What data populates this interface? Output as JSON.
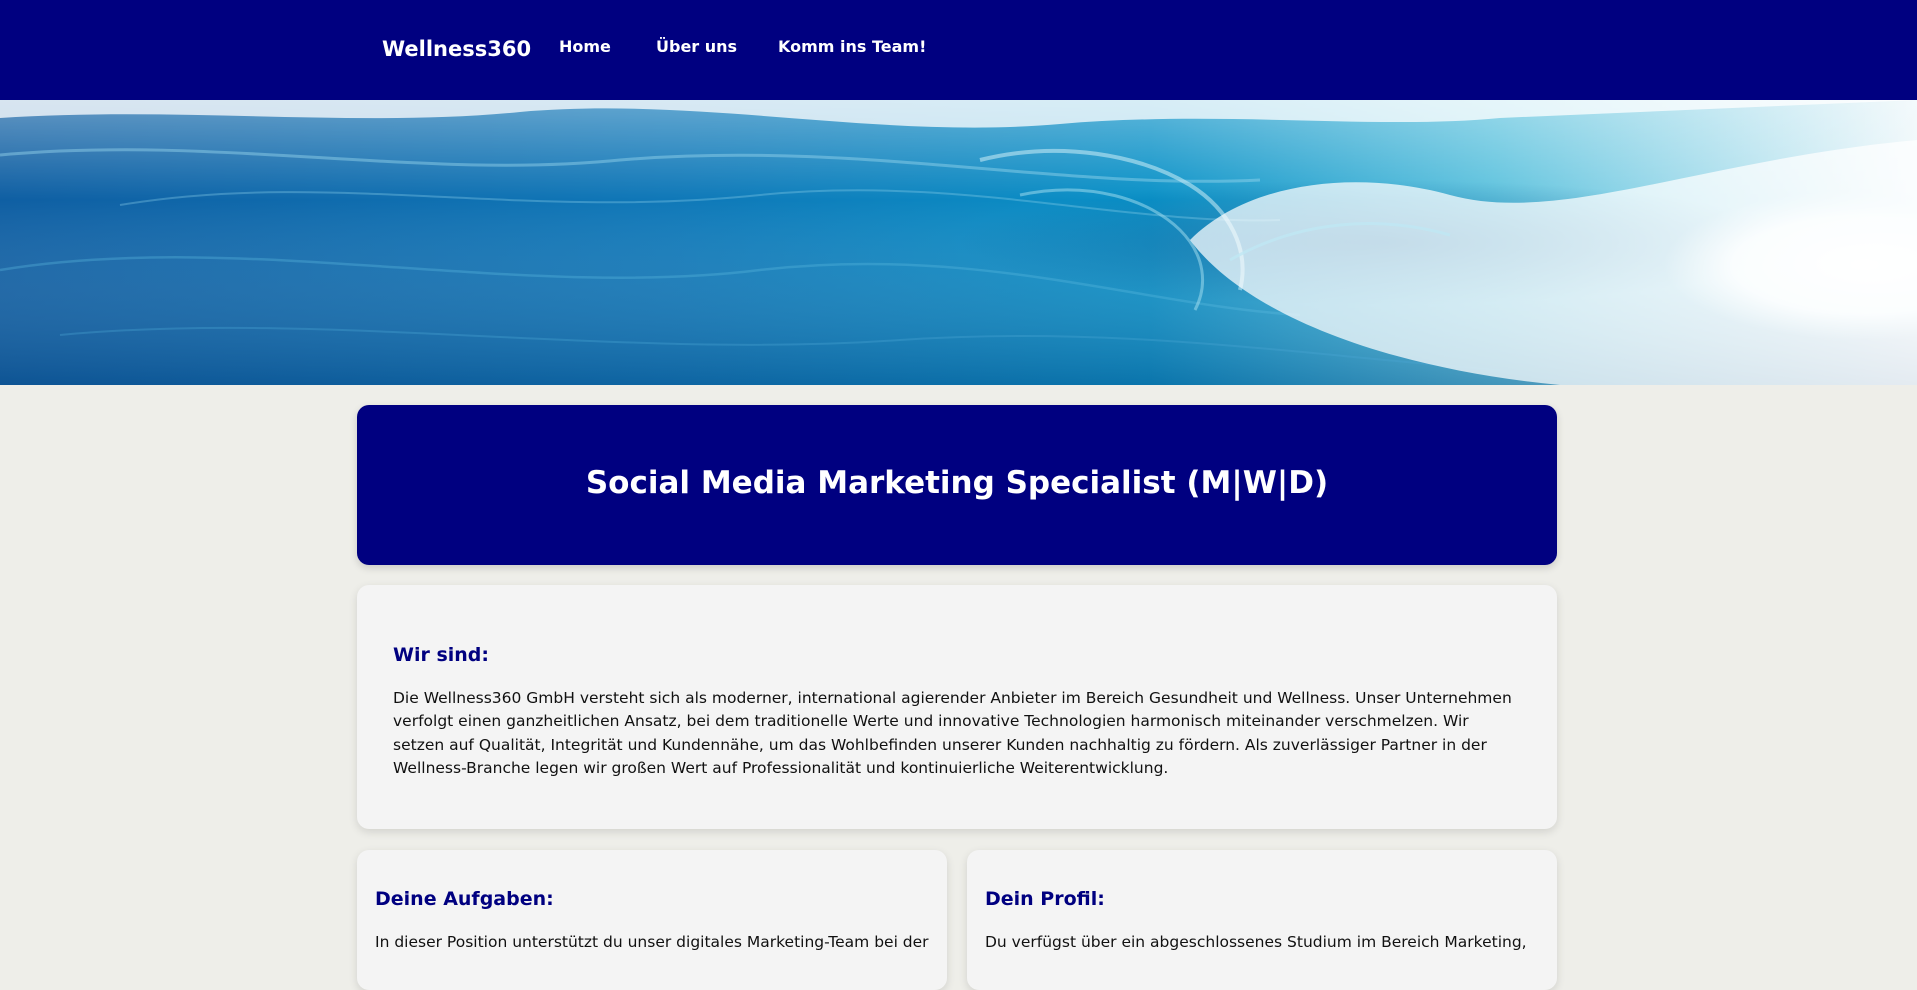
{
  "nav": {
    "brand": "Wellness360",
    "links": [
      {
        "label": "Home"
      },
      {
        "label": "Über uns"
      },
      {
        "label": "Komm ins Team!"
      }
    ]
  },
  "hero": {
    "image": "ocean-wave-banner"
  },
  "job": {
    "title": "Social Media Marketing Specialist (M|W|D)"
  },
  "about": {
    "heading": "Wir sind:",
    "text": "Die Wellness360 GmbH versteht sich als moderner, international agierender Anbieter im Bereich Gesundheit und Wellness. Unser Unternehmen verfolgt einen ganzheitlichen Ansatz, bei dem traditionelle Werte und innovative Technologien harmonisch miteinander verschmelzen. Wir setzen auf Qualität, Integrität und Kundennähe, um das Wohlbefinden unserer Kunden nachhaltig zu fördern. Als zuverlässiger Partner in der Wellness-Branche legen wir großen Wert auf Professionalität und kontinuierliche Weiterentwicklung."
  },
  "tasks": {
    "heading": "Deine Aufgaben:",
    "text": "In dieser Position unterstützt du unser digitales Marketing-Team bei der"
  },
  "profile": {
    "heading": "Dein Profil:",
    "text": "Du verfügst über ein abgeschlossenes Studium im Bereich Marketing,"
  },
  "colors": {
    "primary": "#000080",
    "background": "#eeeee9",
    "card": "#f4f4f4",
    "text": "#111111"
  }
}
